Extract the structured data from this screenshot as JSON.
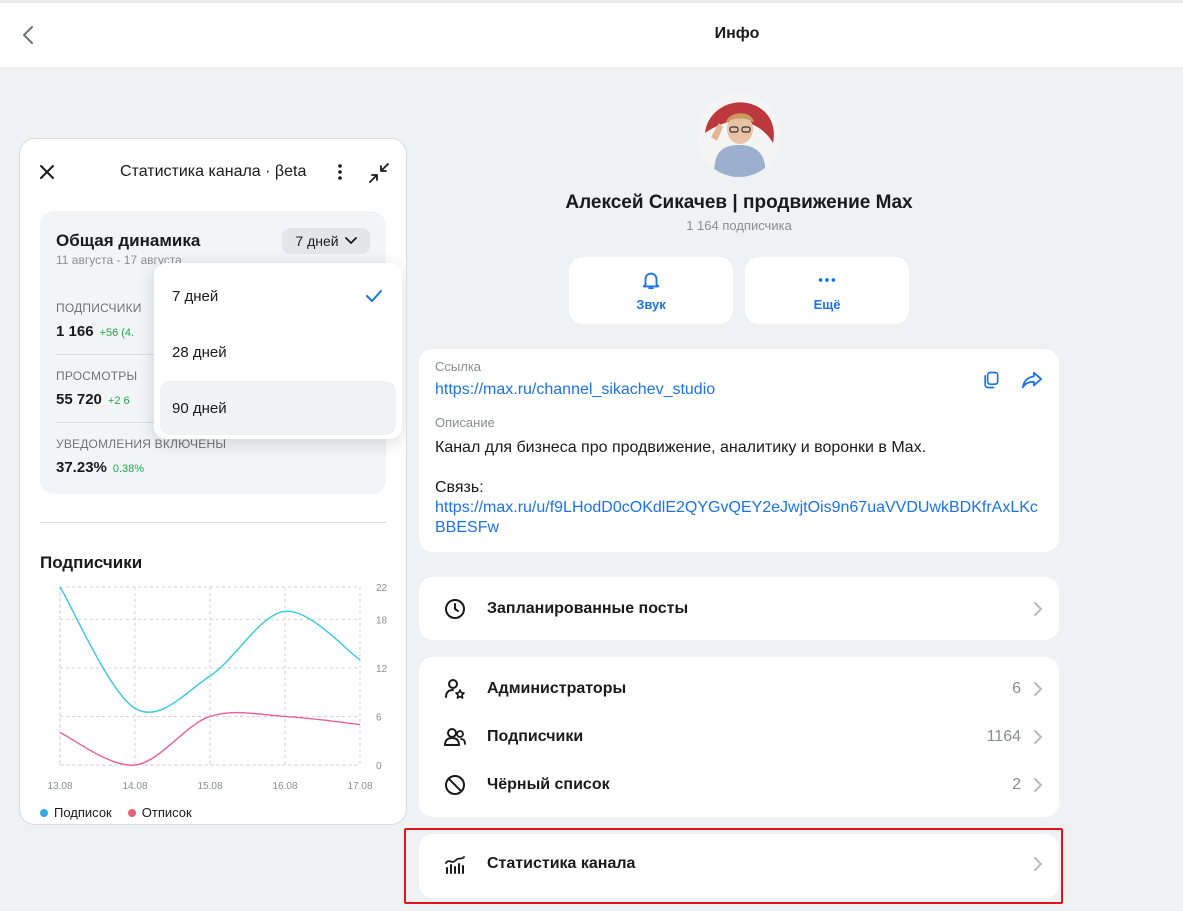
{
  "header": {
    "title": "Инфо"
  },
  "channel": {
    "name": "Алексей Сикачев | продвижение Max",
    "subscribers": "1 164 подписчика"
  },
  "actions": [
    {
      "label": "Звук",
      "icon": "bell-icon"
    },
    {
      "label": "Ещё",
      "icon": "more-dots-icon"
    }
  ],
  "info": {
    "link_label": "Ссылка",
    "link": "https://max.ru/channel_sikachev_studio",
    "desc_label": "Описание",
    "desc_line1": "Канал для бизнеса про продвижение, аналитику и воронки в Max.",
    "desc_line2": "Связь:",
    "contact_link_1": "https://max.ru/u/f9LHodD0cOKdlE2QYGvQEY2eJwjtOis9n67uaVVDUwkBDKfrAxLKc",
    "contact_link_2": "BBESFw"
  },
  "menu": {
    "scheduled": "Запланированные посты",
    "admins": {
      "label": "Администраторы",
      "count": "6"
    },
    "subscribers": {
      "label": "Подписчики",
      "count": "1164"
    },
    "blacklist": {
      "label": "Чёрный список",
      "count": "2"
    },
    "stats": "Статистика канала"
  },
  "panel": {
    "title": "Статистика канала · βeta",
    "dynamics_title": "Общая динамика",
    "dynamics_date": "11 августа - 17 августа",
    "period": "7 дней",
    "stats": [
      {
        "label": "ПОДПИСЧИКИ",
        "value": "1 166",
        "delta": "+56 (4.",
        "delta_color": "#1fa84f"
      },
      {
        "label": "ПРОСМОТРЫ",
        "value": "55 720",
        "delta": "+2 6",
        "delta_color": "#1fa84f"
      },
      {
        "label": "УВЕДОМЛЕНИЯ ВКЛЮЧЕНЫ",
        "value": "37.23%",
        "delta": "0.38%",
        "delta_color": "#1fa84f"
      }
    ],
    "dropdown": [
      {
        "label": "7 дней",
        "selected": true
      },
      {
        "label": "28 дней",
        "selected": false
      },
      {
        "label": "90 дней",
        "selected": false
      }
    ],
    "chart_title": "Подписчики",
    "legend": [
      {
        "name": "Подписок",
        "color": "#3aa8e8"
      },
      {
        "name": "Отписок",
        "color": "#e8607a"
      }
    ]
  },
  "chart_data": {
    "type": "line",
    "title": "Подписчики",
    "x": [
      "13.08",
      "14.08",
      "15.08",
      "16.08",
      "17.08"
    ],
    "y_ticks": [
      0,
      6,
      12,
      18,
      22
    ],
    "ylim": [
      0,
      22
    ],
    "grid": true,
    "legend": "bottom-left",
    "series": [
      {
        "name": "Подписок",
        "color": "#36c9e0",
        "values": [
          22,
          7,
          11,
          19,
          13
        ]
      },
      {
        "name": "Отписок",
        "color": "#e8609a",
        "values": [
          4,
          0,
          6,
          6,
          5
        ]
      }
    ]
  }
}
